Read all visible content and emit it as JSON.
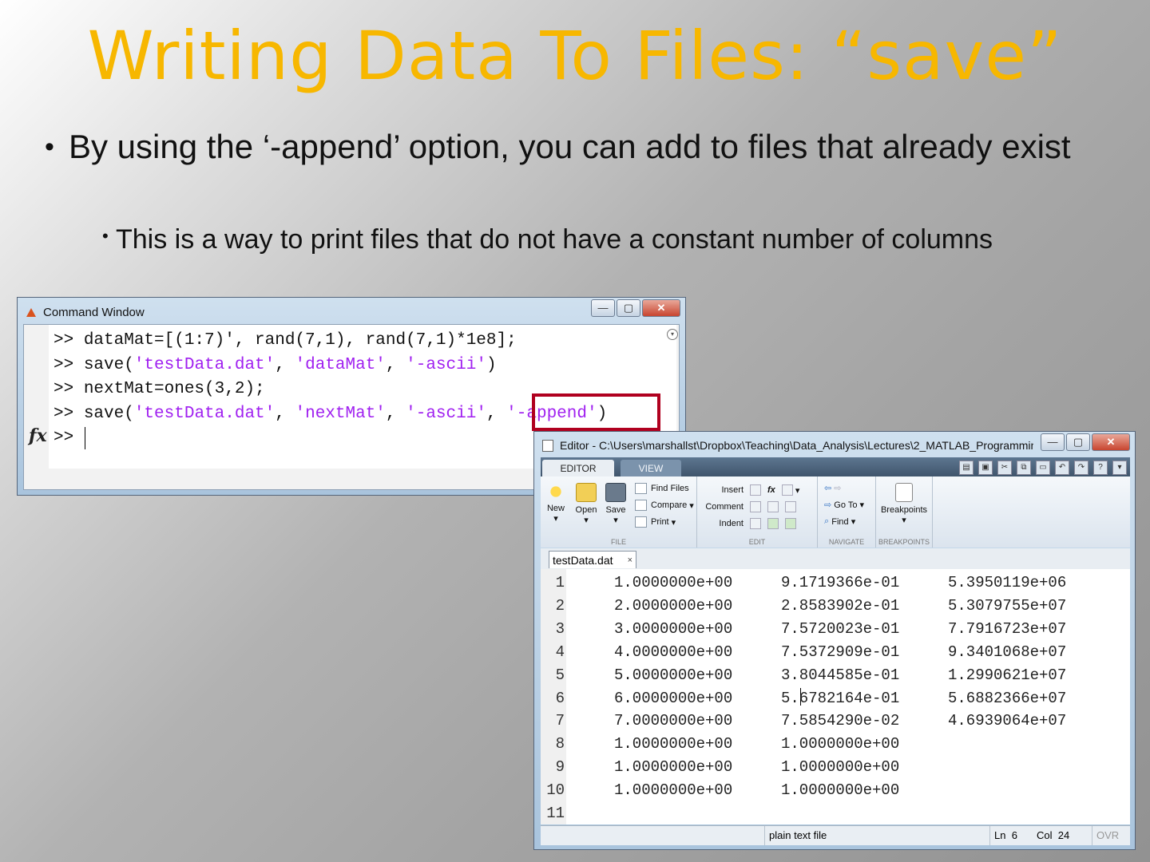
{
  "slide": {
    "title": "Writing Data To Files: “save”",
    "bullet1": "By using the ‘-append’ option, you can add to files that already exist",
    "bullet2": "This is a way to print files that do not have a constant number of columns",
    "bullet_glyph": "•"
  },
  "command_window": {
    "title": "Command Window",
    "prompt": ">>",
    "lines": [
      [
        {
          "t": "dataMat=[(1:7)', rand(7,1), rand(7,1)*1e8];",
          "c": "plain"
        }
      ],
      [
        {
          "t": "save(",
          "c": "plain"
        },
        {
          "t": "'testData.dat'",
          "c": "str"
        },
        {
          "t": ", ",
          "c": "plain"
        },
        {
          "t": "'dataMat'",
          "c": "str"
        },
        {
          "t": ", ",
          "c": "plain"
        },
        {
          "t": "'-ascii'",
          "c": "str"
        },
        {
          "t": ")",
          "c": "plain"
        }
      ],
      [
        {
          "t": "nextMat=ones(3,2);",
          "c": "plain"
        }
      ],
      [
        {
          "t": "save(",
          "c": "plain"
        },
        {
          "t": "'testData.dat'",
          "c": "str"
        },
        {
          "t": ", ",
          "c": "plain"
        },
        {
          "t": "'nextMat'",
          "c": "str"
        },
        {
          "t": ", ",
          "c": "plain"
        },
        {
          "t": "'-ascii'",
          "c": "str"
        },
        {
          "t": ", ",
          "c": "plain"
        },
        {
          "t": "'-append'",
          "c": "str"
        },
        {
          "t": ")",
          "c": "plain"
        }
      ]
    ],
    "fx_label": "fx",
    "window_buttons": {
      "minimize": "—",
      "maximize": "▢",
      "close": "✕"
    }
  },
  "editor": {
    "title": "Editor - C:\\Users\\marshallst\\Dropbox\\Teaching\\Data_Analysis\\Lectures\\2_MATLAB_Programmin...",
    "tabs": [
      "EDITOR",
      "VIEW"
    ],
    "ribbon": {
      "file": {
        "label": "FILE",
        "new": "New",
        "open": "Open",
        "save": "Save",
        "find_files": "Find Files",
        "compare": "Compare",
        "print": "Print"
      },
      "edit": {
        "label": "EDIT",
        "insert": "Insert",
        "comment": "Comment",
        "indent": "Indent"
      },
      "navigate": {
        "label": "NAVIGATE",
        "goto": "Go To",
        "find": "Find"
      },
      "breakpoints": {
        "label": "BREAKPOINTS",
        "button": "Breakpoints"
      }
    },
    "doc_tab": "testData.dat",
    "doc_close": "×",
    "rows": [
      {
        "n": "1",
        "c": [
          "1.0000000e+00",
          "9.1719366e-01",
          "5.3950119e+06"
        ]
      },
      {
        "n": "2",
        "c": [
          "2.0000000e+00",
          "2.8583902e-01",
          "5.3079755e+07"
        ]
      },
      {
        "n": "3",
        "c": [
          "3.0000000e+00",
          "7.5720023e-01",
          "7.7916723e+07"
        ]
      },
      {
        "n": "4",
        "c": [
          "4.0000000e+00",
          "7.5372909e-01",
          "9.3401068e+07"
        ]
      },
      {
        "n": "5",
        "c": [
          "5.0000000e+00",
          "3.8044585e-01",
          "1.2990621e+07"
        ]
      },
      {
        "n": "6",
        "c": [
          "6.0000000e+00",
          "5.6782164e-01",
          "5.6882366e+07"
        ]
      },
      {
        "n": "7",
        "c": [
          "7.0000000e+00",
          "7.5854290e-02",
          "4.6939064e+07"
        ]
      },
      {
        "n": "8",
        "c": [
          "1.0000000e+00",
          "1.0000000e+00"
        ]
      },
      {
        "n": "9",
        "c": [
          "1.0000000e+00",
          "1.0000000e+00"
        ]
      },
      {
        "n": "10",
        "c": [
          "1.0000000e+00",
          "1.0000000e+00"
        ]
      },
      {
        "n": "11",
        "c": []
      }
    ],
    "status": {
      "file_type": "plain text file",
      "ln_label": "Ln",
      "ln": "6",
      "col_label": "Col",
      "col": "24",
      "ovr": "OVR"
    }
  },
  "colors": {
    "title": "#f7b700",
    "string": "#a020f0",
    "highlight_box": "#b0001f"
  }
}
